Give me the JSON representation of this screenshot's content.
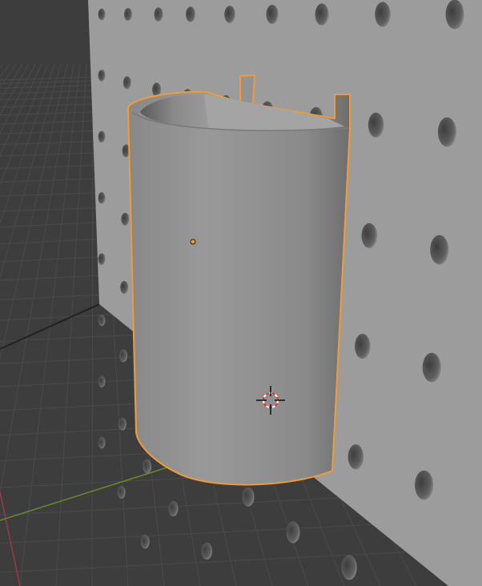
{
  "viewport": {
    "background_color": "#3d3d3d",
    "grid_color": "#4a4a4a",
    "x_axis_color": "#9a3a44",
    "y_axis_color": "#6a8a2a",
    "pegboard_color": "#9c9c9c",
    "hole_color": "#5a5a5a",
    "object_color": "#8e8e8e",
    "selection_color": "#f29b35",
    "icons": [
      "3d-cursor-icon",
      "object-origin-icon"
    ]
  }
}
